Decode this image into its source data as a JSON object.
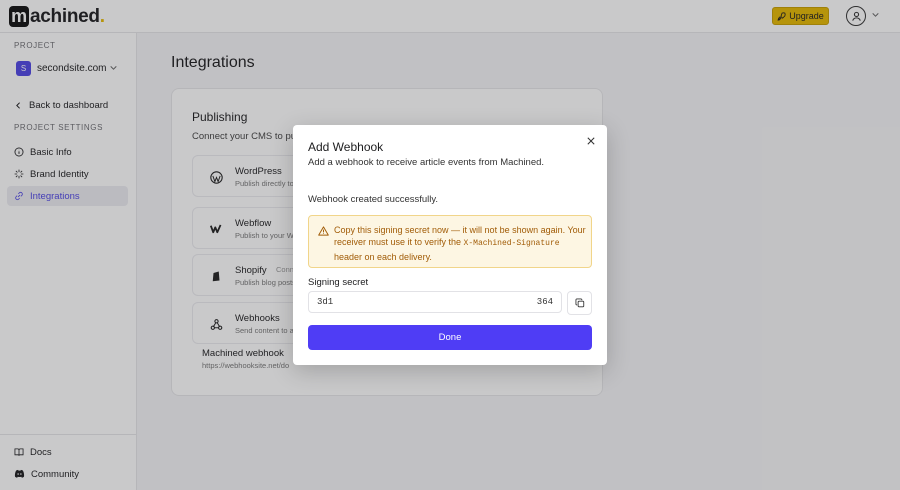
{
  "app": {
    "logo_initial": "m",
    "logo_rest": "achined",
    "logo_dot": ".",
    "upgrade_label": "Upgrade"
  },
  "sidebar": {
    "project_label": "PROJECT",
    "project_initial": "S",
    "project_name": "secondsite.com",
    "back_label": "Back to dashboard",
    "settings_label": "PROJECT SETTINGS",
    "items": [
      {
        "label": "Basic Info",
        "icon": "info-icon"
      },
      {
        "label": "Brand Identity",
        "icon": "sparkle-icon"
      },
      {
        "label": "Integrations",
        "icon": "link-icon",
        "active": true
      }
    ],
    "footer": [
      {
        "label": "Docs",
        "icon": "book-icon"
      },
      {
        "label": "Community",
        "icon": "discord-icon"
      }
    ]
  },
  "main": {
    "title": "Integrations",
    "card": {
      "title": "Publishing",
      "subtitle": "Connect your CMS to publ",
      "integrations": [
        {
          "name": "WordPress",
          "desc": "Publish directly to",
          "icon": "wordpress-icon"
        },
        {
          "name": "Webflow",
          "desc": "Publish to your W",
          "icon": "webflow-icon"
        },
        {
          "name": "Shopify",
          "desc": "Publish blog posts",
          "tag": "Conn",
          "icon": "shopify-icon"
        },
        {
          "name": "Webhooks",
          "desc": "Send content to a",
          "icon": "webhook-icon"
        }
      ],
      "webhook_name": "Machined webhook",
      "webhook_url": "https://webhooksite.net/do                                                                      "
    }
  },
  "modal": {
    "title": "Add Webhook",
    "subtitle": "Add a webhook to receive article events from Machined.",
    "success": "Webhook created successfully.",
    "alert_part1": "Copy this signing secret now — it will not be shown again. Your receiver must use it to verify the ",
    "alert_code": "X-Machined-Signature",
    "alert_part2": " header on each delivery.",
    "secret_label": "Signing secret",
    "secret_start": "3d1",
    "secret_end": "364",
    "done_label": "Done"
  },
  "colors": {
    "accent": "#4f3df5",
    "upgrade": "#e6b800",
    "alert_bg": "#fdf6e3",
    "alert_text": "#a15c07"
  }
}
